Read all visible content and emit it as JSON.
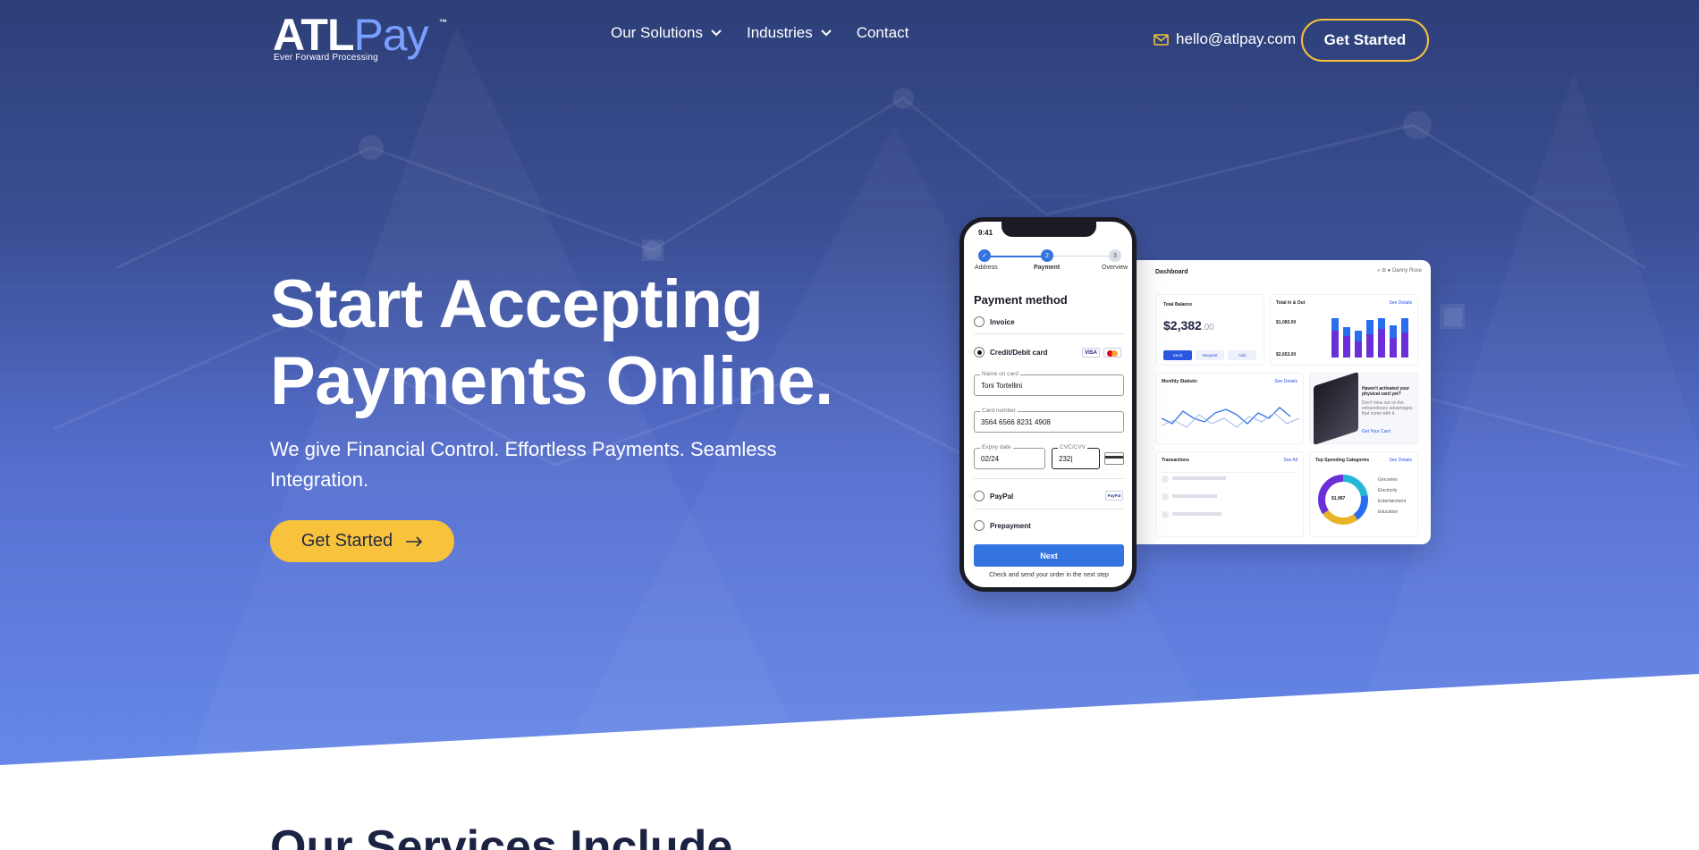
{
  "brand": {
    "logo_atl": "ATL",
    "logo_pay": "Pay",
    "tm": "™",
    "tagline": "Ever Forward Processing"
  },
  "nav": {
    "items": [
      {
        "label": "Our Solutions",
        "has_dropdown": true
      },
      {
        "label": "Industries",
        "has_dropdown": true
      },
      {
        "label": "Contact",
        "has_dropdown": false
      }
    ],
    "email": "hello@atlpay.com",
    "cta_label": "Get Started"
  },
  "hero": {
    "title_line1": "Start Accepting",
    "title_line2": "Payments Online.",
    "subtitle": "We give Financial Control. Effortless Payments. Seamless Integration.",
    "cta_label": "Get Started"
  },
  "dashboard": {
    "title": "Dashboard",
    "user": "Danny Rose",
    "total_balance_label": "Total Balance",
    "total_balance_main": "$2,382",
    "total_balance_cents": ".00",
    "buttons": [
      "Send",
      "Request",
      "Add"
    ],
    "total_in_out_label": "Total In & Out",
    "in_value": "$1,082.00",
    "out_value": "$2,653.00",
    "see_details": "See Details",
    "monthly_label": "Monthly Statistic",
    "promo_title": "Haven't activated your physical card yet?",
    "promo_text": "Don't miss out on the extraordinary advantages that come with it.",
    "promo_link": "Get Your Card",
    "transactions_label": "Transactions",
    "see_all": "See All",
    "categories_label": "Top Spending Categories",
    "donut_value": "$1,987",
    "category_items": [
      "Groceries",
      "Electricity",
      "Entertainment",
      "Education"
    ],
    "colors": {
      "accent": "#6a2fd8",
      "secondary": "#2a6ef0",
      "donut_teal": "#27b7d6",
      "donut_yellow": "#e8b325"
    }
  },
  "phone": {
    "time": "9:41",
    "steps": [
      {
        "num": "✓",
        "label": "Address"
      },
      {
        "num": "2",
        "label": "Payment"
      },
      {
        "num": "3",
        "label": "Overview"
      }
    ],
    "title": "Payment method",
    "options": {
      "invoice": "Invoice",
      "card": "Credit/Debit card",
      "paypal": "PayPal",
      "prepayment": "Prepayment"
    },
    "fields": {
      "name_label": "Name on card",
      "name_value": "Toni Tortellini",
      "number_label": "Card number",
      "number_value": "3564 6566 8231 4908",
      "expiry_label": "Expiry date",
      "expiry_value": "02/24",
      "cvc_label": "CVC/CVV",
      "cvc_value": "232|"
    },
    "next_label": "Next",
    "footer": "Check and send your order in the next step"
  },
  "services": {
    "title": "Our Services Include"
  },
  "colors": {
    "hero_top": "#2d3f78",
    "hero_bottom": "#6789e8",
    "cta_yellow": "#f9c23c",
    "logo_blue": "#7aa0ff"
  },
  "icons": [
    "chevron-down-icon",
    "envelope-icon",
    "arrow-right-icon"
  ]
}
